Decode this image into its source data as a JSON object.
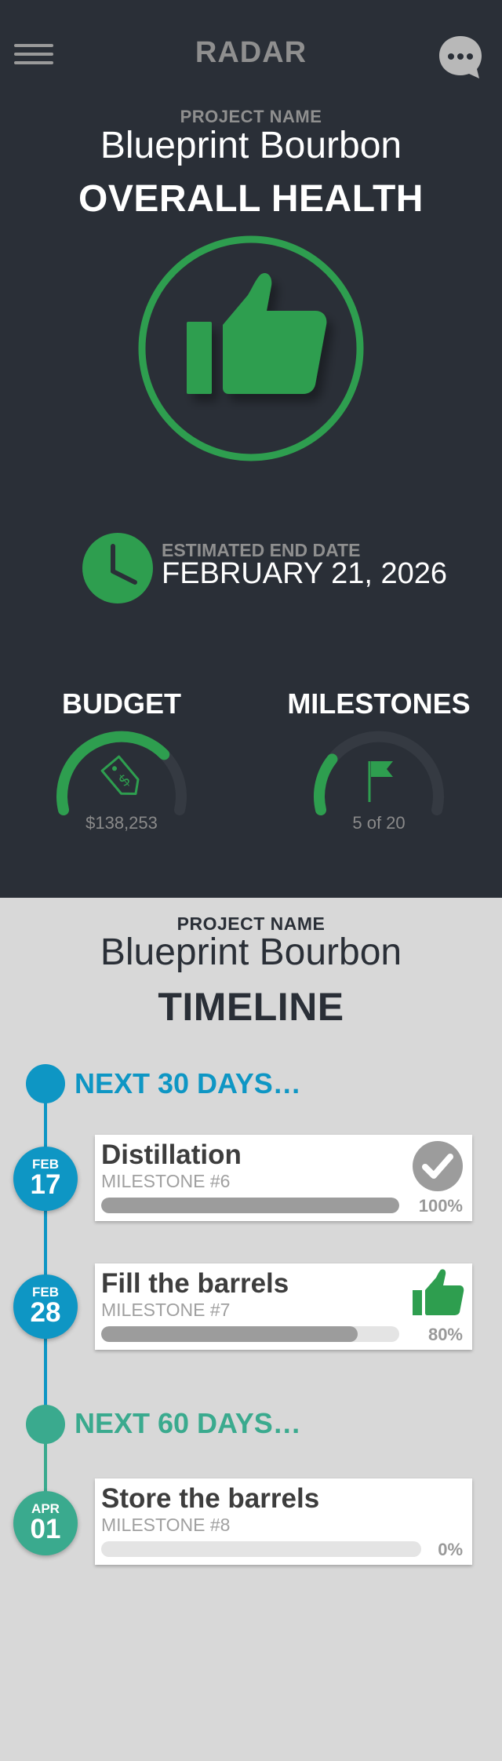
{
  "header": {
    "title": "RADAR"
  },
  "overview": {
    "project_label": "PROJECT NAME",
    "project_name": "Blueprint Bourbon",
    "health_title": "OVERALL HEALTH",
    "health_status": "thumbs-up",
    "end_date_label": "ESTIMATED END DATE",
    "end_date_value": "FEBRUARY 21, 2026",
    "budget": {
      "title": "BUDGET",
      "value": "$138,253",
      "fill_fraction": 0.72
    },
    "milestones": {
      "title": "MILESTONES",
      "value": "5 of 20",
      "fill_fraction": 0.25
    }
  },
  "timeline": {
    "project_label": "PROJECT NAME",
    "project_name": "Blueprint Bourbon",
    "title": "TIMELINE",
    "sections": [
      {
        "label": "NEXT 30 DAYS…",
        "color": "#0e96c4",
        "items": [
          {
            "month": "FEB",
            "day": "17",
            "title": "Distillation",
            "subtitle": "MILESTONE #6",
            "percent": "100%",
            "progress": 1.0,
            "status_icon": "check-circle-icon"
          },
          {
            "month": "FEB",
            "day": "28",
            "title": "Fill the barrels",
            "subtitle": "MILESTONE #7",
            "percent": "80%",
            "progress": 0.86,
            "status_icon": "thumbs-up-icon"
          }
        ]
      },
      {
        "label": "NEXT 60 DAYS…",
        "color": "#3aaa8e",
        "items": [
          {
            "month": "APR",
            "day": "01",
            "title": "Store the barrels",
            "subtitle": "MILESTONE #8",
            "percent": "0%",
            "progress": 0.0,
            "status_icon": ""
          }
        ]
      }
    ]
  },
  "colors": {
    "dark_bg": "#2a2f37",
    "light_bg": "#d8d8d8",
    "accent_green": "#2e9e4f",
    "accent_blue": "#0e96c4",
    "accent_teal": "#3aaa8e"
  }
}
